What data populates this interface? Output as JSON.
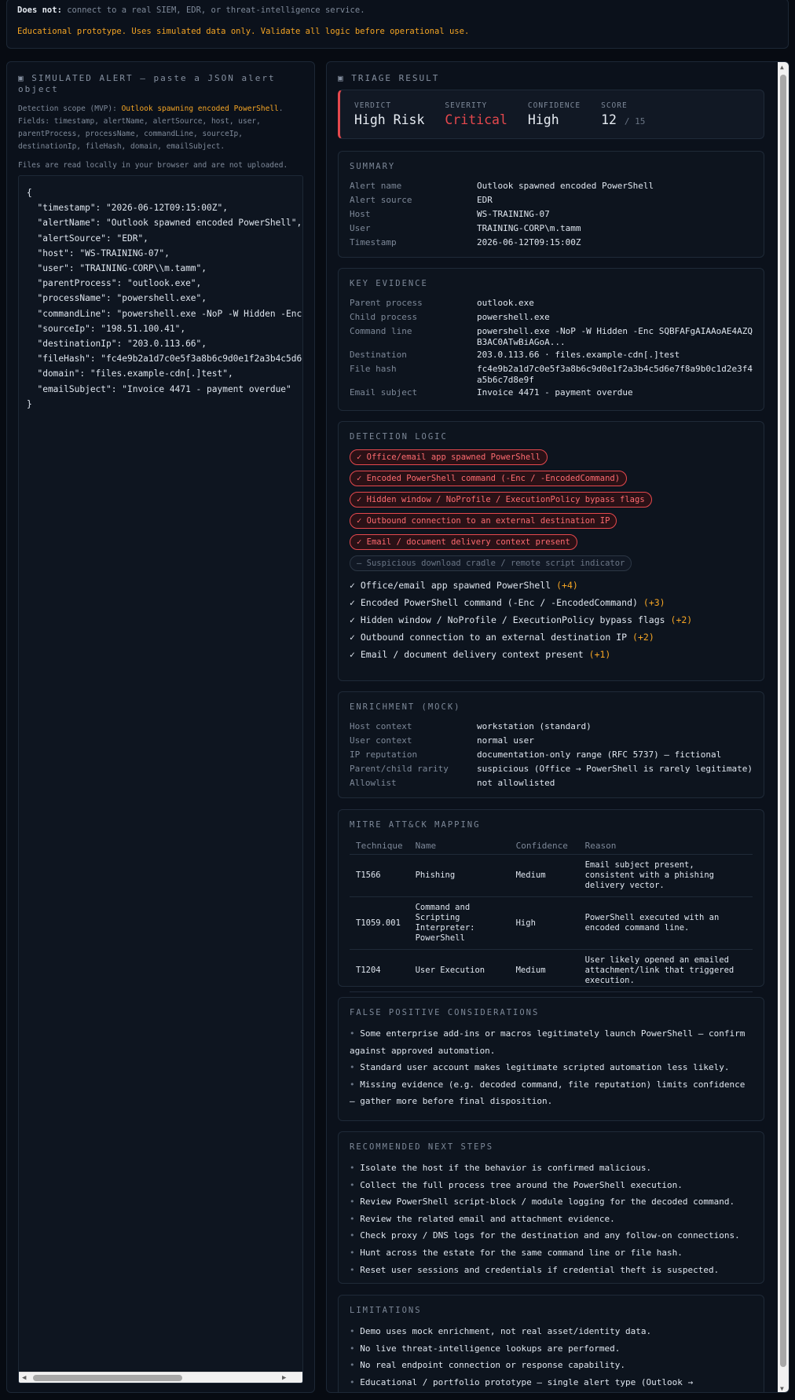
{
  "banner": {
    "does_not_label": "Does not:",
    "does_not_text": "connect to a real SIEM, EDR, or threat-intelligence service.",
    "warning": "Educational prototype. Uses simulated data only. Validate all logic before operational use."
  },
  "alert_panel": {
    "title_icon": "▣",
    "title": "SIMULATED ALERT — paste a JSON alert object",
    "scope_label": "Detection scope (MVP):",
    "scope_value": "Outlook spawning encoded PowerShell",
    "fields_text": "Fields: timestamp, alertName, alertSource, host, user, parentProcess, processName, commandLine, sourceIp, destinationIp, fileHash, domain, emailSubject.",
    "local_note": "Files are read locally in your browser and are not uploaded.",
    "json_text": "{\n  \"timestamp\": \"2026-06-12T09:15:00Z\",\n  \"alertName\": \"Outlook spawned encoded PowerShell\",\n  \"alertSource\": \"EDR\",\n  \"host\": \"WS-TRAINING-07\",\n  \"user\": \"TRAINING-CORP\\\\m.tamm\",\n  \"parentProcess\": \"outlook.exe\",\n  \"processName\": \"powershell.exe\",\n  \"commandLine\": \"powershell.exe -NoP -W Hidden -Enc SQBFAFgAIAAoAE4AZQB3AC0ATwBiAGoA\",\n  \"sourceIp\": \"198.51.100.41\",\n  \"destinationIp\": \"203.0.113.66\",\n  \"fileHash\": \"fc4e9b2a1d7c0e5f3a8b6c9d0e1f2a3b4c5d6e7f8a9b0c1d2e3f4a5b6c7d8e9f\",\n  \"domain\": \"files.example-cdn[.]test\",\n  \"emailSubject\": \"Invoice 4471 - payment overdue\"\n}"
  },
  "triage": {
    "title_icon": "▣",
    "title": "TRIAGE RESULT",
    "verdict": {
      "verdict_label": "VERDICT",
      "verdict_value": "High Risk",
      "severity_label": "SEVERITY",
      "severity_value": "Critical",
      "confidence_label": "CONFIDENCE",
      "confidence_value": "High",
      "score_label": "SCORE",
      "score_value": "12",
      "score_max": "/ 15"
    },
    "summary": {
      "title": "SUMMARY",
      "rows": [
        {
          "k": "Alert name",
          "v": "Outlook spawned encoded PowerShell"
        },
        {
          "k": "Alert source",
          "v": "EDR"
        },
        {
          "k": "Host",
          "v": "WS-TRAINING-07"
        },
        {
          "k": "User",
          "v": "TRAINING-CORP\\m.tamm"
        },
        {
          "k": "Timestamp",
          "v": "2026-06-12T09:15:00Z"
        }
      ]
    },
    "evidence": {
      "title": "KEY EVIDENCE",
      "rows": [
        {
          "k": "Parent process",
          "v": "outlook.exe"
        },
        {
          "k": "Child process",
          "v": "powershell.exe"
        },
        {
          "k": "Command line",
          "v": "powershell.exe -NoP -W Hidden -Enc SQBFAFgAIAAoAE4AZQB3AC0ATwBiAGoA..."
        },
        {
          "k": "Destination",
          "v": "203.0.113.66 · files.example-cdn[.]test"
        },
        {
          "k": "File hash",
          "v": "fc4e9b2a1d7c0e5f3a8b6c9d0e1f2a3b4c5d6e7f8a9b0c1d2e3f4a5b6c7d8e9f"
        },
        {
          "k": "Email subject",
          "v": "Invoice 4471 - payment overdue"
        }
      ]
    },
    "detection": {
      "title": "DETECTION LOGIC",
      "chips": [
        "✓ Office/email app spawned PowerShell",
        "✓ Encoded PowerShell command (-Enc / -EncodedCommand)",
        "✓ Hidden window / NoProfile / ExecutionPolicy bypass flags",
        "✓ Outbound connection to an external destination IP",
        "✓ Email / document delivery context present"
      ],
      "chip_inactive": "– Suspicious download cradle / remote script indicator",
      "checks": [
        {
          "text": "✓ Office/email app spawned PowerShell",
          "pts": "(+4)"
        },
        {
          "text": "✓ Encoded PowerShell command (-Enc / -EncodedCommand)",
          "pts": "(+3)"
        },
        {
          "text": "✓ Hidden window / NoProfile / ExecutionPolicy bypass flags",
          "pts": "(+2)"
        },
        {
          "text": "✓ Outbound connection to an external destination IP",
          "pts": "(+2)"
        },
        {
          "text": "✓ Email / document delivery context present",
          "pts": "(+1)"
        }
      ]
    },
    "enrichment": {
      "title": "ENRICHMENT (MOCK)",
      "rows": [
        {
          "k": "Host context",
          "v": "workstation (standard)"
        },
        {
          "k": "User context",
          "v": "normal user"
        },
        {
          "k": "IP reputation",
          "v": "documentation-only range (RFC 5737) — fictional"
        },
        {
          "k": "Parent/child rarity",
          "v": "suspicious (Office → PowerShell is rarely legitimate)"
        },
        {
          "k": "Allowlist",
          "v": "not allowlisted"
        }
      ]
    },
    "mitre": {
      "title": "MITRE ATT&CK MAPPING",
      "headers": [
        "Technique",
        "Name",
        "Confidence",
        "Reason"
      ],
      "rows": [
        {
          "id": "T1566",
          "name": "Phishing",
          "conf": "Medium",
          "reason": "Email subject present, consistent with a phishing delivery vector."
        },
        {
          "id": "T1059.001",
          "name": "Command and Scripting Interpreter: PowerShell",
          "conf": "High",
          "reason": "PowerShell executed with an encoded command line."
        },
        {
          "id": "T1204",
          "name": "User Execution",
          "conf": "Medium",
          "reason": "User likely opened an emailed attachment/link that triggered execution."
        }
      ]
    },
    "false_positives": {
      "title": "FALSE POSITIVE CONSIDERATIONS",
      "items": [
        "Some enterprise add-ins or macros legitimately launch PowerShell — confirm against approved automation.",
        "Standard user account makes legitimate scripted automation less likely.",
        "Missing evidence (e.g. decoded command, file reputation) limits confidence — gather more before final disposition."
      ]
    },
    "next_steps": {
      "title": "RECOMMENDED NEXT STEPS",
      "items": [
        "Isolate the host if the behavior is confirmed malicious.",
        "Collect the full process tree around the PowerShell execution.",
        "Review PowerShell script-block / module logging for the decoded command.",
        "Review the related email and attachment evidence.",
        "Check proxy / DNS logs for the destination and any follow-on connections.",
        "Hunt across the estate for the same command line or file hash.",
        "Reset user sessions and credentials if credential theft is suspected."
      ]
    },
    "limitations": {
      "title": "LIMITATIONS",
      "items": [
        "Demo uses mock enrichment, not real asset/identity data.",
        "No live threat-intelligence lookups are performed.",
        "No real endpoint connection or response capability.",
        "Educational / portfolio prototype — single alert type (Outlook →"
      ]
    }
  }
}
